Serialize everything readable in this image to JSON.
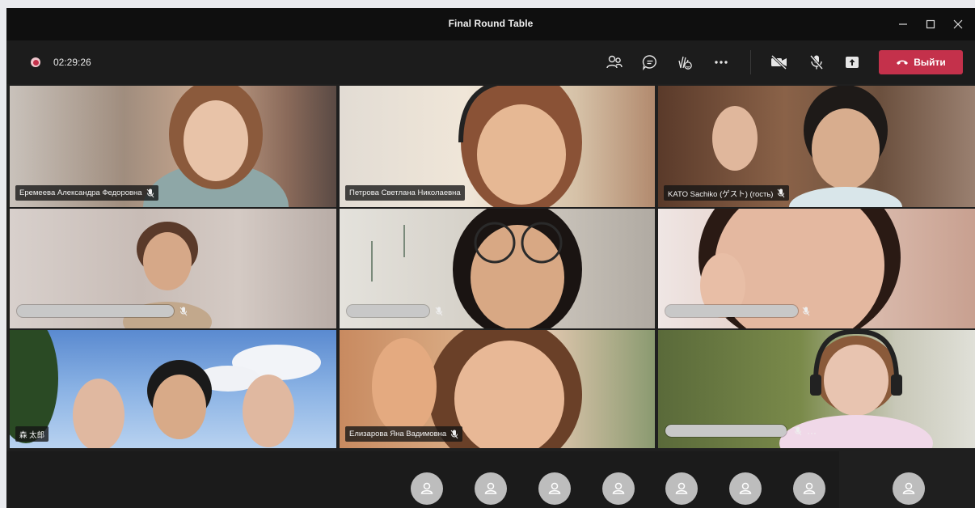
{
  "window": {
    "title": "Final Round Table"
  },
  "toolbar": {
    "timer": "02:29:26",
    "leave_label": "Выйти"
  },
  "participants": [
    {
      "name": "Еремеева Александра Федоровна",
      "muted": true
    },
    {
      "name": "Петрова Светлана Николаевна",
      "muted": false
    },
    {
      "name": "KATO Sachiko (ゲスト) (гость)",
      "muted": true
    },
    {
      "name": "",
      "muted": true
    },
    {
      "name": "",
      "muted": true
    },
    {
      "name": "",
      "muted": true
    },
    {
      "name": "森 太郎",
      "muted": false
    },
    {
      "name": "Елизарова Яна Вадимовна",
      "muted": true
    },
    {
      "name": "",
      "muted": true
    },
    {
      "ellipsis": "···"
    }
  ],
  "colors": {
    "leave": "#c4314b",
    "background": "#1f1f1f",
    "recording": "#c4314b"
  },
  "icons": [
    "people-icon",
    "chat-icon",
    "raise-hand-icon",
    "more-icon",
    "camera-off-icon",
    "mic-off-icon",
    "share-tray-icon",
    "hang-up-icon",
    "minimize-icon",
    "maximize-icon",
    "close-icon",
    "avatar-icon"
  ]
}
